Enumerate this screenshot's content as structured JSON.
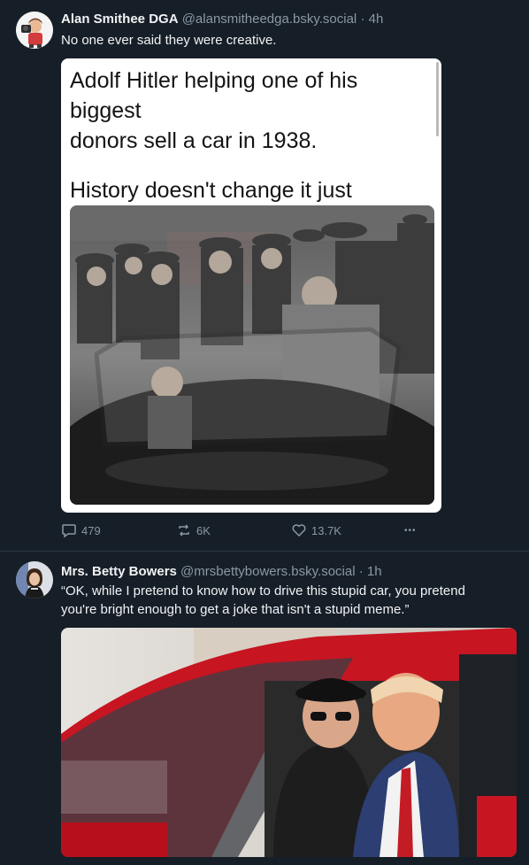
{
  "posts": [
    {
      "author_name": "Alan Smithee DGA",
      "handle": "@alansmitheedga.bsky.social",
      "separator": "·",
      "time": "4h",
      "text": "No one ever said they were creative.",
      "embed": {
        "line1": "Adolf Hitler helping one of his biggest",
        "line2": "donors sell a car in 1938.",
        "line3": "History doesn't change it just repeats."
      },
      "actions": {
        "replies": "479",
        "reposts": "6K",
        "likes": "13.7K",
        "more": "•••"
      }
    },
    {
      "author_name": "Mrs. Betty Bowers",
      "handle": "@mrsbettybowers.bsky.social",
      "separator": "·",
      "time": "1h",
      "text": "“OK, while I pretend to know how to drive this stupid car, you pretend you're bright enough to get a joke that isn't a stupid meme.”"
    }
  ],
  "icons": {
    "reply": "comment-bubble-icon",
    "repost": "repost-arrows-icon",
    "like": "heart-icon",
    "more": "more-dots-icon"
  },
  "colors": {
    "background": "#161e27",
    "text": "#f1f3f5",
    "muted": "#8b98a5",
    "divider": "#2e3a45"
  }
}
